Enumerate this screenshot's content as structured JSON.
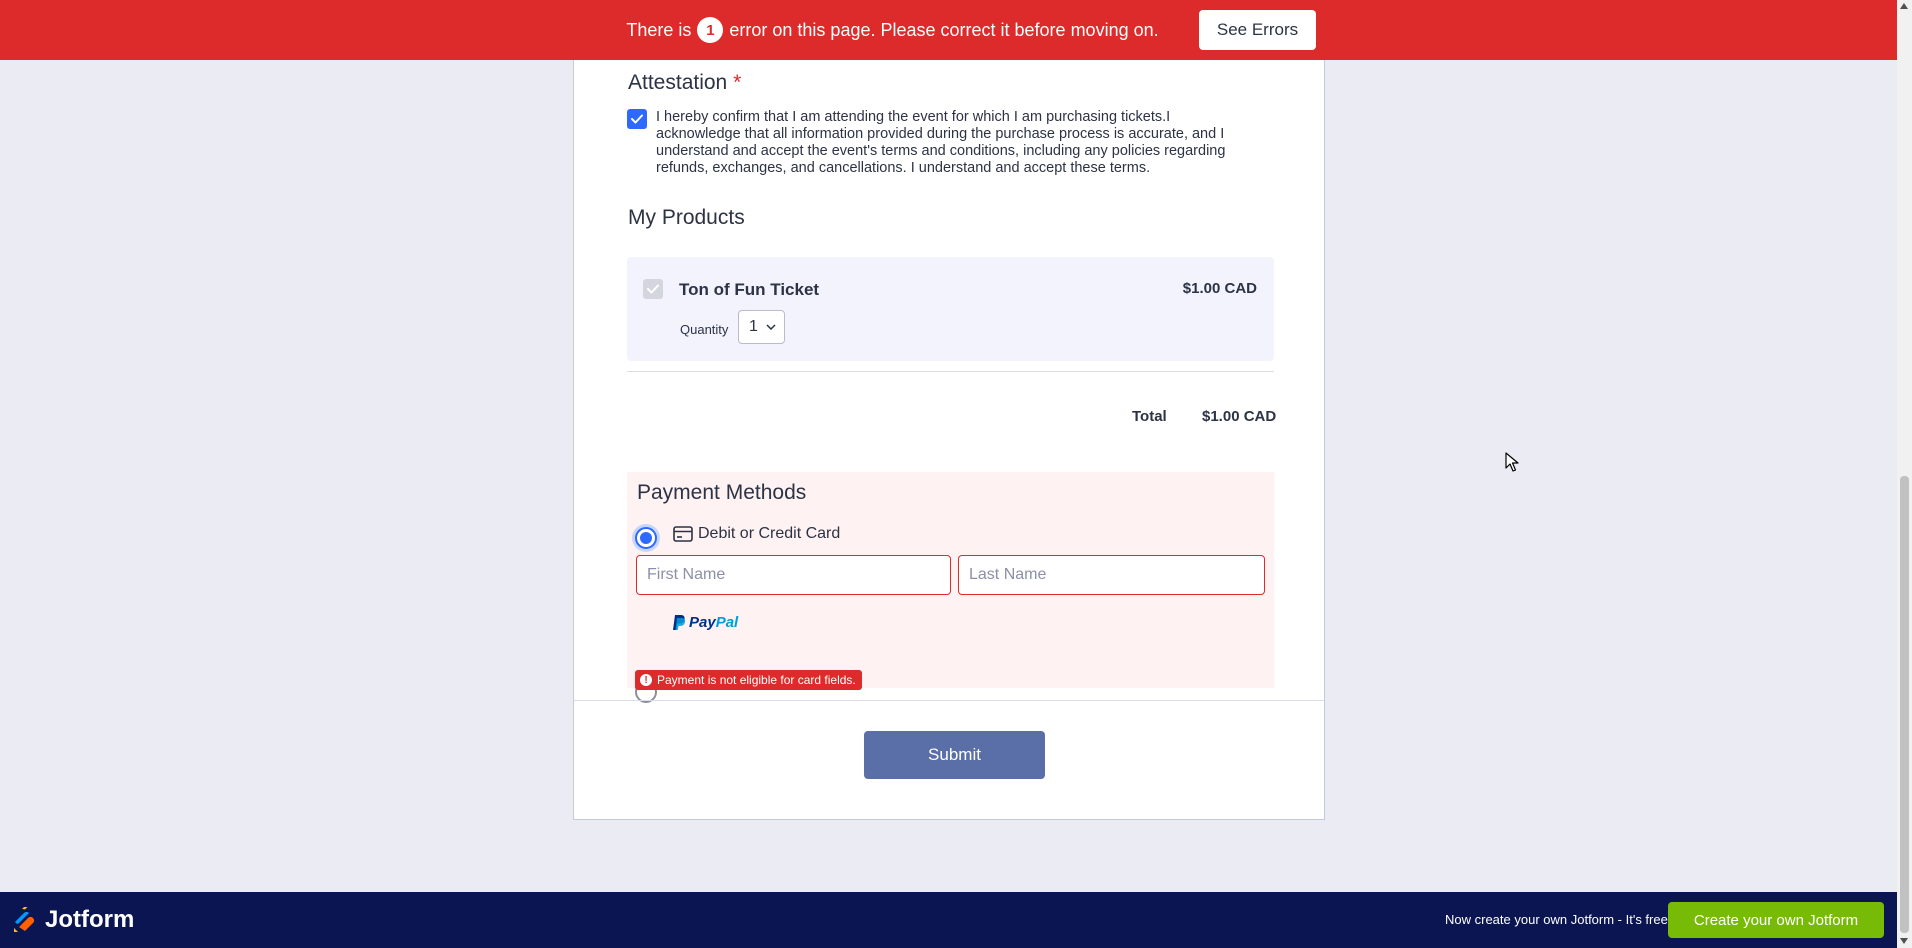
{
  "error_banner": {
    "prefix": "There is",
    "count": "1",
    "suffix": "error on this page. Please correct it before moving on.",
    "see_errors_label": "See Errors"
  },
  "attestation": {
    "title": "Attestation",
    "required_mark": "*",
    "checked": true,
    "text": "I hereby confirm that I am attending the event for which I am purchasing tickets.I acknowledge that all information provided during the purchase process is accurate, and I understand and accept the event's terms and conditions, including any policies regarding refunds, exchanges, and cancellations. I understand and accept these terms."
  },
  "products": {
    "title": "My Products",
    "items": [
      {
        "name": "Ton of Fun Ticket",
        "price": "$1.00 CAD",
        "quantity_label": "Quantity",
        "quantity": "1",
        "checked": true
      }
    ],
    "total_label": "Total",
    "total_value": "$1.00 CAD"
  },
  "payment": {
    "title": "Payment Methods",
    "card_option_label": "Debit or Credit Card",
    "card_selected": true,
    "first_name_placeholder": "First Name",
    "last_name_placeholder": "Last Name",
    "paypal_pay": "Pay",
    "paypal_pal": "Pal",
    "error_message": "Payment is not eligible for card fields."
  },
  "submit_label": "Submit",
  "footer": {
    "brand": "Jotform",
    "message": "Now create your own Jotform - It's free!",
    "cta_label": "Create your own Jotform"
  },
  "colors": {
    "error_red": "#dd2a2a",
    "accent_blue": "#2e69ff",
    "submit_bg": "#5a6ea8",
    "footer_bg": "#0a1551",
    "cta_green": "#78bb07"
  }
}
